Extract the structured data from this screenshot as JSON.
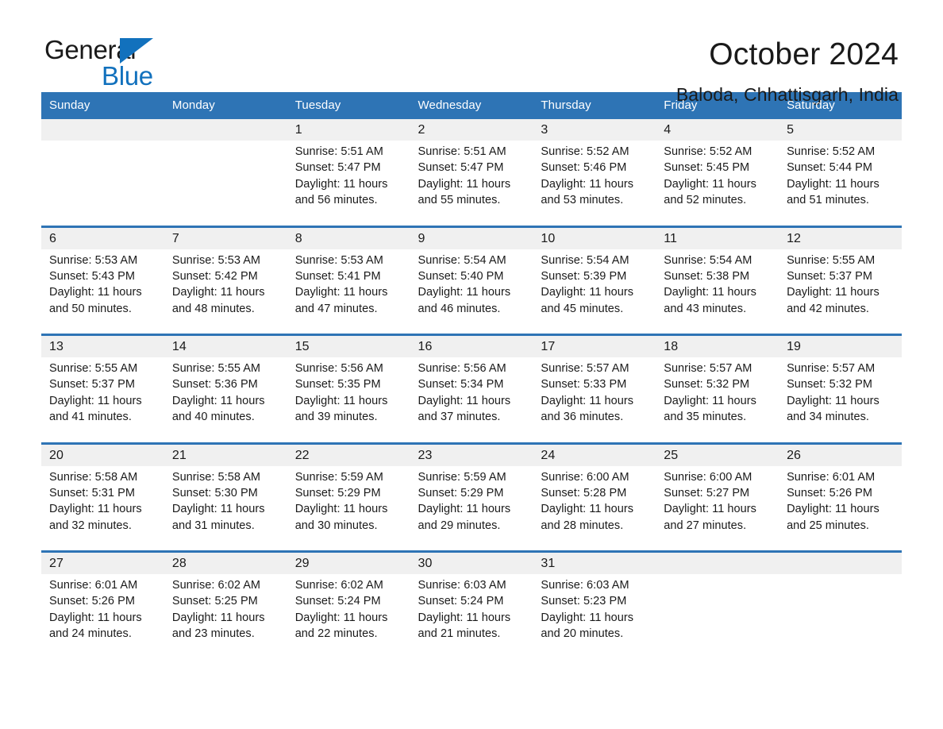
{
  "brand": {
    "name_part1": "General",
    "name_part2": "Blue",
    "triangle_icon": "brand-triangle-icon",
    "colors": {
      "blue": "#1271bd",
      "black": "#1a1a1a"
    }
  },
  "header": {
    "title": "October 2024",
    "subtitle": "Baloda, Chhattisgarh, India"
  },
  "theme": {
    "header_blue": "#2e74b5",
    "daynum_band": "#f0f0f0",
    "text": "#1a1a1a"
  },
  "calendar": {
    "day_headers": [
      "Sunday",
      "Monday",
      "Tuesday",
      "Wednesday",
      "Thursday",
      "Friday",
      "Saturday"
    ],
    "labels": {
      "sunrise_prefix": "Sunrise:",
      "sunset_prefix": "Sunset:",
      "daylight_prefix": "Daylight:"
    },
    "weeks": [
      {
        "days": [
          {
            "num": "",
            "empty": true
          },
          {
            "num": "",
            "empty": true
          },
          {
            "num": "1",
            "sunrise": "Sunrise: 5:51 AM",
            "sunset": "Sunset: 5:47 PM",
            "daylight": "Daylight: 11 hours and 56 minutes."
          },
          {
            "num": "2",
            "sunrise": "Sunrise: 5:51 AM",
            "sunset": "Sunset: 5:47 PM",
            "daylight": "Daylight: 11 hours and 55 minutes."
          },
          {
            "num": "3",
            "sunrise": "Sunrise: 5:52 AM",
            "sunset": "Sunset: 5:46 PM",
            "daylight": "Daylight: 11 hours and 53 minutes."
          },
          {
            "num": "4",
            "sunrise": "Sunrise: 5:52 AM",
            "sunset": "Sunset: 5:45 PM",
            "daylight": "Daylight: 11 hours and 52 minutes."
          },
          {
            "num": "5",
            "sunrise": "Sunrise: 5:52 AM",
            "sunset": "Sunset: 5:44 PM",
            "daylight": "Daylight: 11 hours and 51 minutes."
          }
        ]
      },
      {
        "days": [
          {
            "num": "6",
            "sunrise": "Sunrise: 5:53 AM",
            "sunset": "Sunset: 5:43 PM",
            "daylight": "Daylight: 11 hours and 50 minutes."
          },
          {
            "num": "7",
            "sunrise": "Sunrise: 5:53 AM",
            "sunset": "Sunset: 5:42 PM",
            "daylight": "Daylight: 11 hours and 48 minutes."
          },
          {
            "num": "8",
            "sunrise": "Sunrise: 5:53 AM",
            "sunset": "Sunset: 5:41 PM",
            "daylight": "Daylight: 11 hours and 47 minutes."
          },
          {
            "num": "9",
            "sunrise": "Sunrise: 5:54 AM",
            "sunset": "Sunset: 5:40 PM",
            "daylight": "Daylight: 11 hours and 46 minutes."
          },
          {
            "num": "10",
            "sunrise": "Sunrise: 5:54 AM",
            "sunset": "Sunset: 5:39 PM",
            "daylight": "Daylight: 11 hours and 45 minutes."
          },
          {
            "num": "11",
            "sunrise": "Sunrise: 5:54 AM",
            "sunset": "Sunset: 5:38 PM",
            "daylight": "Daylight: 11 hours and 43 minutes."
          },
          {
            "num": "12",
            "sunrise": "Sunrise: 5:55 AM",
            "sunset": "Sunset: 5:37 PM",
            "daylight": "Daylight: 11 hours and 42 minutes."
          }
        ]
      },
      {
        "days": [
          {
            "num": "13",
            "sunrise": "Sunrise: 5:55 AM",
            "sunset": "Sunset: 5:37 PM",
            "daylight": "Daylight: 11 hours and 41 minutes."
          },
          {
            "num": "14",
            "sunrise": "Sunrise: 5:55 AM",
            "sunset": "Sunset: 5:36 PM",
            "daylight": "Daylight: 11 hours and 40 minutes."
          },
          {
            "num": "15",
            "sunrise": "Sunrise: 5:56 AM",
            "sunset": "Sunset: 5:35 PM",
            "daylight": "Daylight: 11 hours and 39 minutes."
          },
          {
            "num": "16",
            "sunrise": "Sunrise: 5:56 AM",
            "sunset": "Sunset: 5:34 PM",
            "daylight": "Daylight: 11 hours and 37 minutes."
          },
          {
            "num": "17",
            "sunrise": "Sunrise: 5:57 AM",
            "sunset": "Sunset: 5:33 PM",
            "daylight": "Daylight: 11 hours and 36 minutes."
          },
          {
            "num": "18",
            "sunrise": "Sunrise: 5:57 AM",
            "sunset": "Sunset: 5:32 PM",
            "daylight": "Daylight: 11 hours and 35 minutes."
          },
          {
            "num": "19",
            "sunrise": "Sunrise: 5:57 AM",
            "sunset": "Sunset: 5:32 PM",
            "daylight": "Daylight: 11 hours and 34 minutes."
          }
        ]
      },
      {
        "days": [
          {
            "num": "20",
            "sunrise": "Sunrise: 5:58 AM",
            "sunset": "Sunset: 5:31 PM",
            "daylight": "Daylight: 11 hours and 32 minutes."
          },
          {
            "num": "21",
            "sunrise": "Sunrise: 5:58 AM",
            "sunset": "Sunset: 5:30 PM",
            "daylight": "Daylight: 11 hours and 31 minutes."
          },
          {
            "num": "22",
            "sunrise": "Sunrise: 5:59 AM",
            "sunset": "Sunset: 5:29 PM",
            "daylight": "Daylight: 11 hours and 30 minutes."
          },
          {
            "num": "23",
            "sunrise": "Sunrise: 5:59 AM",
            "sunset": "Sunset: 5:29 PM",
            "daylight": "Daylight: 11 hours and 29 minutes."
          },
          {
            "num": "24",
            "sunrise": "Sunrise: 6:00 AM",
            "sunset": "Sunset: 5:28 PM",
            "daylight": "Daylight: 11 hours and 28 minutes."
          },
          {
            "num": "25",
            "sunrise": "Sunrise: 6:00 AM",
            "sunset": "Sunset: 5:27 PM",
            "daylight": "Daylight: 11 hours and 27 minutes."
          },
          {
            "num": "26",
            "sunrise": "Sunrise: 6:01 AM",
            "sunset": "Sunset: 5:26 PM",
            "daylight": "Daylight: 11 hours and 25 minutes."
          }
        ]
      },
      {
        "days": [
          {
            "num": "27",
            "sunrise": "Sunrise: 6:01 AM",
            "sunset": "Sunset: 5:26 PM",
            "daylight": "Daylight: 11 hours and 24 minutes."
          },
          {
            "num": "28",
            "sunrise": "Sunrise: 6:02 AM",
            "sunset": "Sunset: 5:25 PM",
            "daylight": "Daylight: 11 hours and 23 minutes."
          },
          {
            "num": "29",
            "sunrise": "Sunrise: 6:02 AM",
            "sunset": "Sunset: 5:24 PM",
            "daylight": "Daylight: 11 hours and 22 minutes."
          },
          {
            "num": "30",
            "sunrise": "Sunrise: 6:03 AM",
            "sunset": "Sunset: 5:24 PM",
            "daylight": "Daylight: 11 hours and 21 minutes."
          },
          {
            "num": "31",
            "sunrise": "Sunrise: 6:03 AM",
            "sunset": "Sunset: 5:23 PM",
            "daylight": "Daylight: 11 hours and 20 minutes."
          },
          {
            "num": "",
            "empty": true
          },
          {
            "num": "",
            "empty": true
          }
        ]
      }
    ]
  }
}
